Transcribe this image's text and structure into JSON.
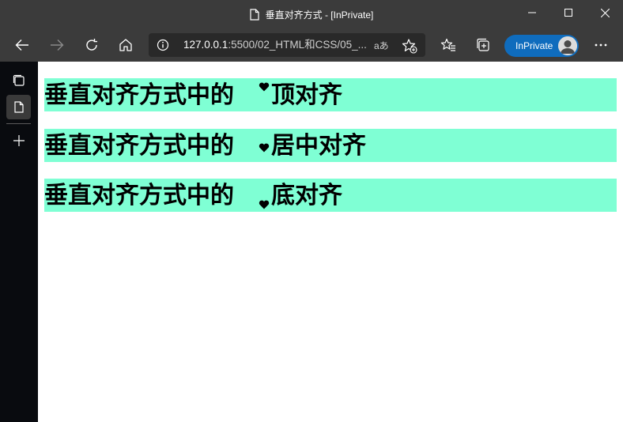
{
  "window": {
    "title": "垂直对齐方式 - [InPrivate]"
  },
  "toolbar": {
    "url_host": "127.0.0.1",
    "url_rest": ":5500/02_HTML和CSS/05_...",
    "read_aloud": "aあ",
    "inprivate_label": "InPrivate"
  },
  "rows": [
    {
      "prefix": "垂直对齐方式中的",
      "suffix": "顶对齐",
      "align": "top"
    },
    {
      "prefix": "垂直对齐方式中的",
      "suffix": "居中对齐",
      "align": "middle"
    },
    {
      "prefix": "垂直对齐方式中的",
      "suffix": "底对齐",
      "align": "bottom"
    }
  ],
  "colors": {
    "row_background": "#7fffd4",
    "chrome": "#3b3b3b",
    "accent": "#0f6cbd"
  },
  "icons": [
    "page-icon",
    "minimize-icon",
    "maximize-icon",
    "close-icon",
    "back-icon",
    "forward-icon",
    "refresh-icon",
    "home-icon",
    "info-icon",
    "favorite-add-icon",
    "favorites-icon",
    "collections-icon",
    "more-icon",
    "tabs-icon",
    "heart-icon",
    "plus-icon"
  ]
}
